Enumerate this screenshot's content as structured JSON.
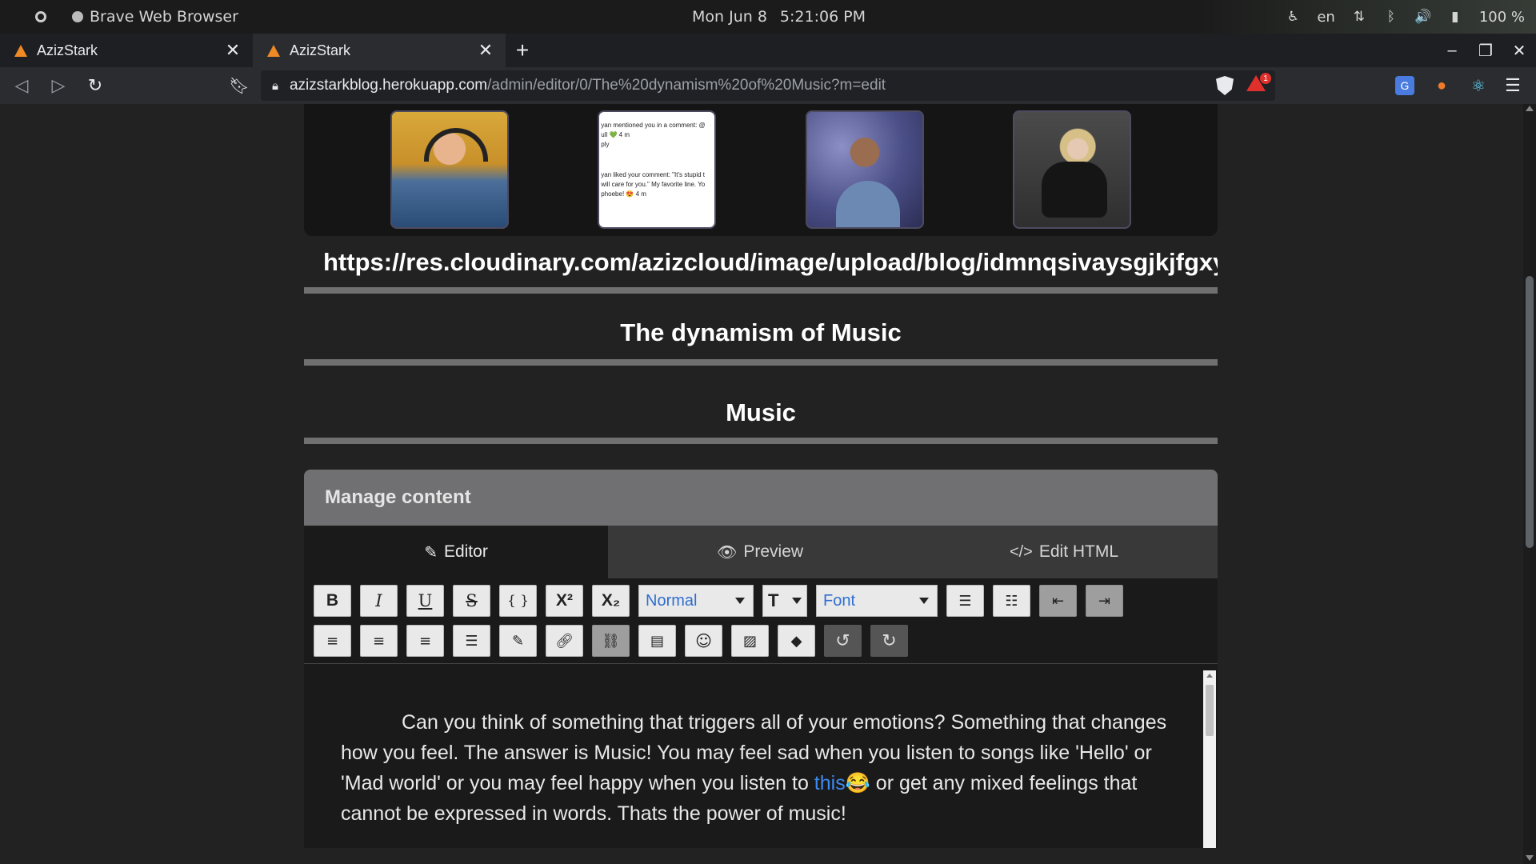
{
  "os": {
    "app_name": "Brave Web Browser",
    "date": "Mon Jun 8",
    "time": "5:21:06 PM",
    "language": "en",
    "battery": "100 %"
  },
  "tabs": [
    {
      "title": "AzizStark",
      "close": "✕"
    },
    {
      "title": "AzizStark",
      "close": "✕"
    }
  ],
  "new_tab": "+",
  "window": {
    "minimize": "–",
    "restore": "❐",
    "close": "✕"
  },
  "address": {
    "host": "azizstarkblog.herokuapp.com",
    "path": "/admin/editor/0/The%20dynamism%20of%20Music?m=edit",
    "rewards_badge": "1"
  },
  "gallery": {
    "notification_lines": [
      "yan mentioned you in a comment: @",
      "ull 💚 4 m",
      "ply",
      "yan liked your comment: \"It's stupid t",
      "will care for you.\" My favorite line. Yo",
      "phoebe! 😍 4 m"
    ]
  },
  "form": {
    "image_url": "https://res.cloudinary.com/azizcloud/image/upload/blog/idmnqsivaysgjkjfgxyz",
    "title": "The dynamism of Music",
    "category": "Music"
  },
  "panel": {
    "heading": "Manage content",
    "tabs": [
      {
        "label": "Editor",
        "icon": "✎"
      },
      {
        "label": "Preview",
        "icon": "👁"
      },
      {
        "label": "Edit HTML",
        "icon": "</>"
      }
    ]
  },
  "toolbar": {
    "heading_select": "Normal",
    "font_select": "Font",
    "size_label": "T",
    "bold": "B",
    "italic": "I",
    "underline": "U",
    "strike": "S",
    "code": "{ }",
    "superscript": "X²",
    "subscript": "X₂"
  },
  "editor": {
    "text_before": "Can you think of something that triggers all of your emotions? Something that changes how you feel. The answer is Music! You may feel sad when you listen to songs like 'Hello' or 'Mad world' or you may feel happy when you listen to ",
    "link_text": "this",
    "emoji": "😂",
    "text_after": " or get any mixed feelings that cannot be expressed in words. Thats the power of music!"
  }
}
